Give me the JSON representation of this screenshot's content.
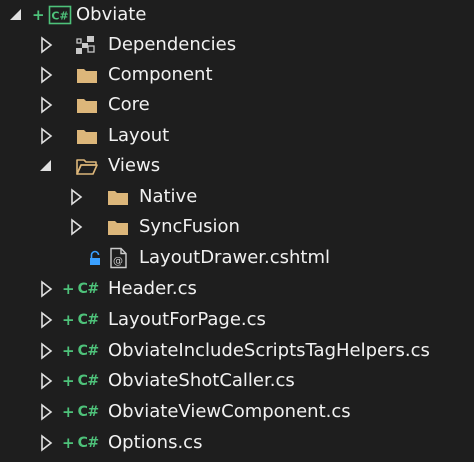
{
  "colors": {
    "background": "#1e1e1e",
    "text": "#f1f1f1",
    "csharp_green": "#4ec27a",
    "folder": "#dcb67a",
    "lock": "#3aa0ff"
  },
  "tree": {
    "root": {
      "label": "Obviate",
      "badge": "C#",
      "plus": "+",
      "expanded": true,
      "icon": "csharp-project-icon"
    },
    "dependencies": {
      "label": "Dependencies",
      "icon": "dependencies-icon"
    },
    "folders": [
      {
        "label": "Component",
        "icon": "folder-icon"
      },
      {
        "label": "Core",
        "icon": "folder-icon"
      },
      {
        "label": "Layout",
        "icon": "folder-icon"
      }
    ],
    "views": {
      "label": "Views",
      "expanded": true,
      "icon": "folder-open-icon",
      "children": [
        {
          "label": "Native",
          "icon": "folder-icon"
        },
        {
          "label": "SyncFusion",
          "icon": "folder-icon"
        }
      ],
      "file": {
        "label": "LayoutDrawer.cshtml",
        "icon": "razor-file-icon",
        "locked": true
      }
    },
    "cs_badge": "C#",
    "cs_plus": "+",
    "files": [
      {
        "label": "Header.cs"
      },
      {
        "label": "LayoutForPage.cs"
      },
      {
        "label": "ObviateIncludeScriptsTagHelpers.cs"
      },
      {
        "label": "ObviateShotCaller.cs"
      },
      {
        "label": "ObviateViewComponent.cs"
      },
      {
        "label": "Options.cs"
      }
    ]
  }
}
